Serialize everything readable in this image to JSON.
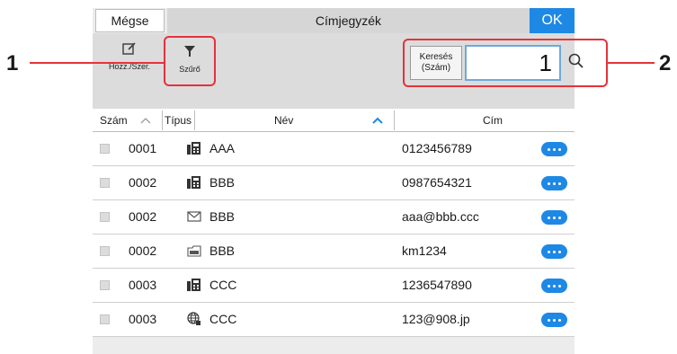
{
  "header": {
    "cancel_label": "Mégse",
    "title": "Címjegyzék",
    "ok_label": "OK"
  },
  "toolbar": {
    "add_edit_label": "Hozz./Szer.",
    "filter_label": "Szűrő",
    "search_key_line1": "Keresés",
    "search_key_line2": "(Szám)",
    "search_value": "1"
  },
  "callouts": {
    "left": "1",
    "right": "2"
  },
  "colors": {
    "accent": "#1e88e5",
    "callout": "#e5323b"
  },
  "columns": {
    "number": "Szám",
    "type": "Típus",
    "name": "Név",
    "address": "Cím"
  },
  "rows": [
    {
      "number": "0001",
      "type_icon": "fax-icon",
      "name": "AAA",
      "address": "0123456789"
    },
    {
      "number": "0002",
      "type_icon": "fax-icon",
      "name": "BBB",
      "address": "0987654321"
    },
    {
      "number": "0002",
      "type_icon": "email-icon",
      "name": "BBB",
      "address": "aaa@bbb.ccc"
    },
    {
      "number": "0002",
      "type_icon": "smb-icon",
      "name": "BBB",
      "address": "km1234"
    },
    {
      "number": "0003",
      "type_icon": "fax-icon",
      "name": "CCC",
      "address": "1236547890"
    },
    {
      "number": "0003",
      "type_icon": "globe-icon",
      "name": "CCC",
      "address": "123@908.jp"
    }
  ]
}
